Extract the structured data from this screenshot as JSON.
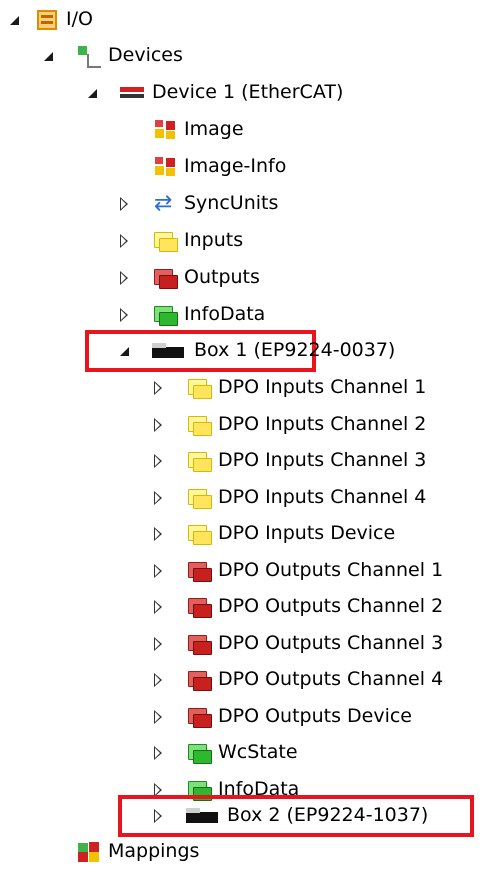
{
  "tree": {
    "io": {
      "label": "I/O"
    },
    "devices": {
      "label": "Devices"
    },
    "device1": {
      "label": "Device 1 (EtherCAT)"
    },
    "image": {
      "label": "Image"
    },
    "image_info": {
      "label": "Image-Info"
    },
    "syncunits": {
      "label": "SyncUnits"
    },
    "inputs": {
      "label": "Inputs"
    },
    "outputs": {
      "label": "Outputs"
    },
    "infodata": {
      "label": "InfoData"
    },
    "box1": {
      "label": "Box 1 (EP9224-0037)"
    },
    "box1_children": [
      {
        "label": "DPO Inputs Channel 1",
        "icon": "input-vars-icon"
      },
      {
        "label": "DPO Inputs Channel 2",
        "icon": "input-vars-icon"
      },
      {
        "label": "DPO Inputs Channel 3",
        "icon": "input-vars-icon"
      },
      {
        "label": "DPO Inputs Channel 4",
        "icon": "input-vars-icon"
      },
      {
        "label": "DPO Inputs Device",
        "icon": "input-vars-icon"
      },
      {
        "label": "DPO Outputs Channel 1",
        "icon": "output-vars-icon"
      },
      {
        "label": "DPO Outputs Channel 2",
        "icon": "output-vars-icon"
      },
      {
        "label": "DPO Outputs Channel 3",
        "icon": "output-vars-icon"
      },
      {
        "label": "DPO Outputs Channel 4",
        "icon": "output-vars-icon"
      },
      {
        "label": "DPO Outputs Device",
        "icon": "output-vars-icon"
      },
      {
        "label": "WcState",
        "icon": "infodata-icon"
      },
      {
        "label": "InfoData",
        "icon": "infodata-icon"
      }
    ],
    "box2": {
      "label": "Box 2 (EP9224-1037)"
    },
    "mappings": {
      "label": "Mappings"
    }
  },
  "colors": {
    "highlight": "#e8141e",
    "input_icon": "#ffe45c",
    "output_icon": "#c8201e",
    "infodata_icon": "#2eb82e"
  }
}
